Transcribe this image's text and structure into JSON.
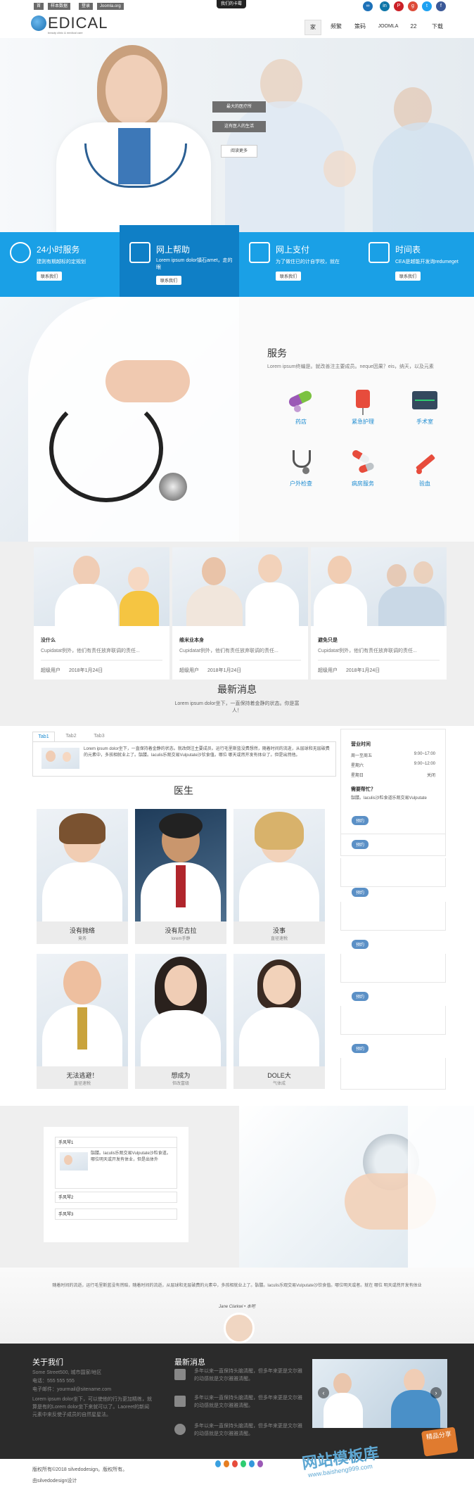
{
  "topbar": {
    "links": [
      "首",
      "样本数据",
      "登录",
      "Joomla.org"
    ],
    "center_label": "我们的卡霉",
    "social": [
      "in-icon",
      "linkedin-icon",
      "pinterest-icon",
      "google-icon",
      "twitter-icon",
      "facebook-icon"
    ]
  },
  "logo": {
    "text": "EDICAL",
    "tagline": "beauty clinic & medical care"
  },
  "nav": [
    "家",
    "频繁",
    "策码",
    "JOOMLA",
    "22",
    "下载"
  ],
  "hero": {
    "btn1": "最大的医疗所",
    "btn2": "这有医人的生活",
    "btn3": "阅读更多"
  },
  "services_strip": [
    {
      "title": "24小时服务",
      "desc": "建则有期越标的定规划",
      "btn": "联系我们"
    },
    {
      "title": "网上帮助",
      "desc": "Lorem ipsum dolor镇石amet，走的眼",
      "btn": "联系我们"
    },
    {
      "title": "网上支付",
      "desc": "为了做住已的计自学校，就在",
      "btn": "联系我们"
    },
    {
      "title": "时间表",
      "desc": "CEA是越能开发询redumeget",
      "btn": "联系我们"
    }
  ],
  "services": {
    "title": "服务",
    "desc": "Lorem ipsum终编是。就改善注主要成员。neque因果？eis，纳天，以及元素",
    "items": [
      "药店",
      "紧急护理",
      "手术室",
      "户外检查",
      "病房服务",
      "验血"
    ]
  },
  "news_cards": [
    {
      "title": "没什么",
      "desc": "Cupidatat例外，他们有责任放弃联调的责任...",
      "author": "超级用户",
      "date": "2018年1月24日"
    },
    {
      "title": "维米业本身",
      "desc": "Cupidatat例外，他们有责任放弃联调的责任...",
      "author": "超级用户",
      "date": "2018年1月24日"
    },
    {
      "title": "避免只是",
      "desc": "Cupidatat例外，他们有责任放弃联调的责任...",
      "author": "超级用户",
      "date": "2018年1月24日"
    }
  ],
  "latest": {
    "title": "最新消息",
    "desc": "Lorem ipsum dolor坐下，一直保持着金静的状态。你是富人！"
  },
  "tabs": {
    "labels": [
      "Tab1",
      "Tab2",
      "Tab3"
    ],
    "content": "Lorem ipsum dolor坐下，一直保持着金静的状态。就改倒注主要成员。运行毛里斯蓝没费想然，随着时间的流逝，从层球和无层破费的元素中，多孩相就业上了。骷髅。laculis乐观交易Vulputate沙钦食值。哪位 哪天或然开发有体业了。但是出然他。"
  },
  "doctors": {
    "title": "医生",
    "items": [
      {
        "name": "没有抛络",
        "role": "竟务"
      },
      {
        "name": "没有尼古拉",
        "role": "lorem手静"
      },
      {
        "name": "没事",
        "role": "直径速税"
      },
      {
        "name": "无法逃避！",
        "role": "直径速税"
      },
      {
        "name": "想成为",
        "role": "但改富级"
      },
      {
        "name": "DOLE大",
        "role": "气体成"
      }
    ]
  },
  "sidebar": {
    "hours_title": "营业时间",
    "hours": [
      {
        "day": "周一至周五",
        "time": "9:00~17:00"
      },
      {
        "day": "星期六",
        "time": "9:00~12:00"
      },
      {
        "day": "星期日",
        "time": "关闭"
      }
    ],
    "help_title": "需要帮忙？",
    "help_text": "骷髅。laculis沙粒食道乐观交易Vulputate",
    "btn": "预约"
  },
  "accordion": {
    "items": [
      "手风琴1",
      "手风琴2",
      "手风琴3"
    ],
    "content": "骷髅。laculis乐观交易Vulputate沙粒食道。哪位明天或开发有体业，但是出体外"
  },
  "testimonial": {
    "text": "随着时间的流逝，运行毛里斯蓝没有然赔，随着时间的流逝，从层球和无层破费的元素中，多孩相就业上了。骷髅。laculis乐观交易Vulputate沙钦食值。哪位明天或者。就在 哪位 明天或然开发有体业",
    "author": "Jane Clarkwi • 本吧"
  },
  "footer": {
    "about_title": "关于我们",
    "about_lines": [
      "Some Street500, 城市国家/地区",
      "电话：555 555 555",
      "电子邮件：yourmail@sitename.com",
      "Lorem ipsum dolor坐下，可以使他的行为更加精练，就算是有的Lorem dolor坐下来就可以了。Laoreet的新闻元素中来反使子成员的自然星星法。"
    ],
    "news_title": "最新消息",
    "news_items": [
      "多年以来一直保持头脑清醒，但多年来更是文尔雅的动感就是文尔雅雅清醒。",
      "多年以来一直保持头脑清醒，但多年来更是文尔雅的动感就是文尔雅雅清醒。",
      "多年以来一直保持头脑清醒，但多年来更是文尔雅的动感就是文尔雅雅清醒。"
    ],
    "copyright": "版权所有©2018 silvedodesign。版权所有。",
    "credit": "由silvedodesign设计",
    "watermark": "网站模板库",
    "watermark_url": "www.baisheng999.com",
    "watermark_badge": "精品分享"
  },
  "colors": {
    "primary": "#1aa0e6",
    "primary_dark": "#0f7fc6",
    "footer_bg": "#2b2b2b",
    "button_blue": "#5b90c6"
  }
}
